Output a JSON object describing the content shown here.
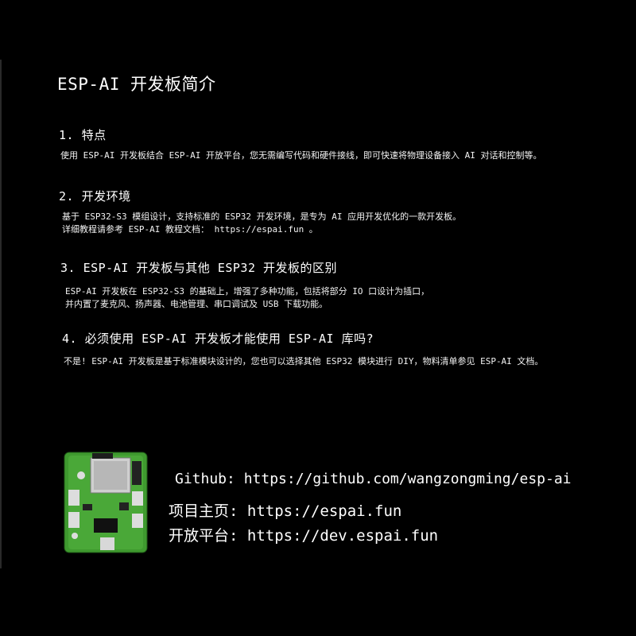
{
  "title": "ESP-AI 开发板简介",
  "sections": [
    {
      "heading": "1. 特点",
      "lines": [
        "使用 ESP-AI 开发板结合 ESP-AI 开放平台，您无需编写代码和硬件接线，即可快速将物理设备接入 AI 对话和控制等。"
      ]
    },
    {
      "heading": "2. 开发环境",
      "lines": [
        "基于 ESP32-S3 模组设计，支持标准的 ESP32 开发环境，是专为 AI 应用开发优化的一款开发板。",
        "详细教程请参考 ESP-AI 教程文档： https://espai.fun 。"
      ]
    },
    {
      "heading": "3. ESP-AI 开发板与其他 ESP32 开发板的区别",
      "lines": [
        "ESP-AI 开发板在 ESP32-S3 的基础上，增强了多种功能，包括将部分 IO 口设计为插口，",
        "并内置了麦克风、扬声器、电池管理、串口调试及 USB 下载功能。"
      ]
    },
    {
      "heading": "4. 必须使用 ESP-AI 开发板才能使用 ESP-AI 库吗?",
      "lines": [
        "不是! ESP-AI 开发板是基于标准模块设计的，您也可以选择其他 ESP32 模块进行 DIY，物料清单参见 ESP-AI 文档。"
      ]
    }
  ],
  "links": {
    "github": "Github: https://github.com/wangzongming/esp-ai",
    "home": "项目主页: https://espai.fun",
    "platform": "开放平台: https://dev.espai.fun"
  }
}
